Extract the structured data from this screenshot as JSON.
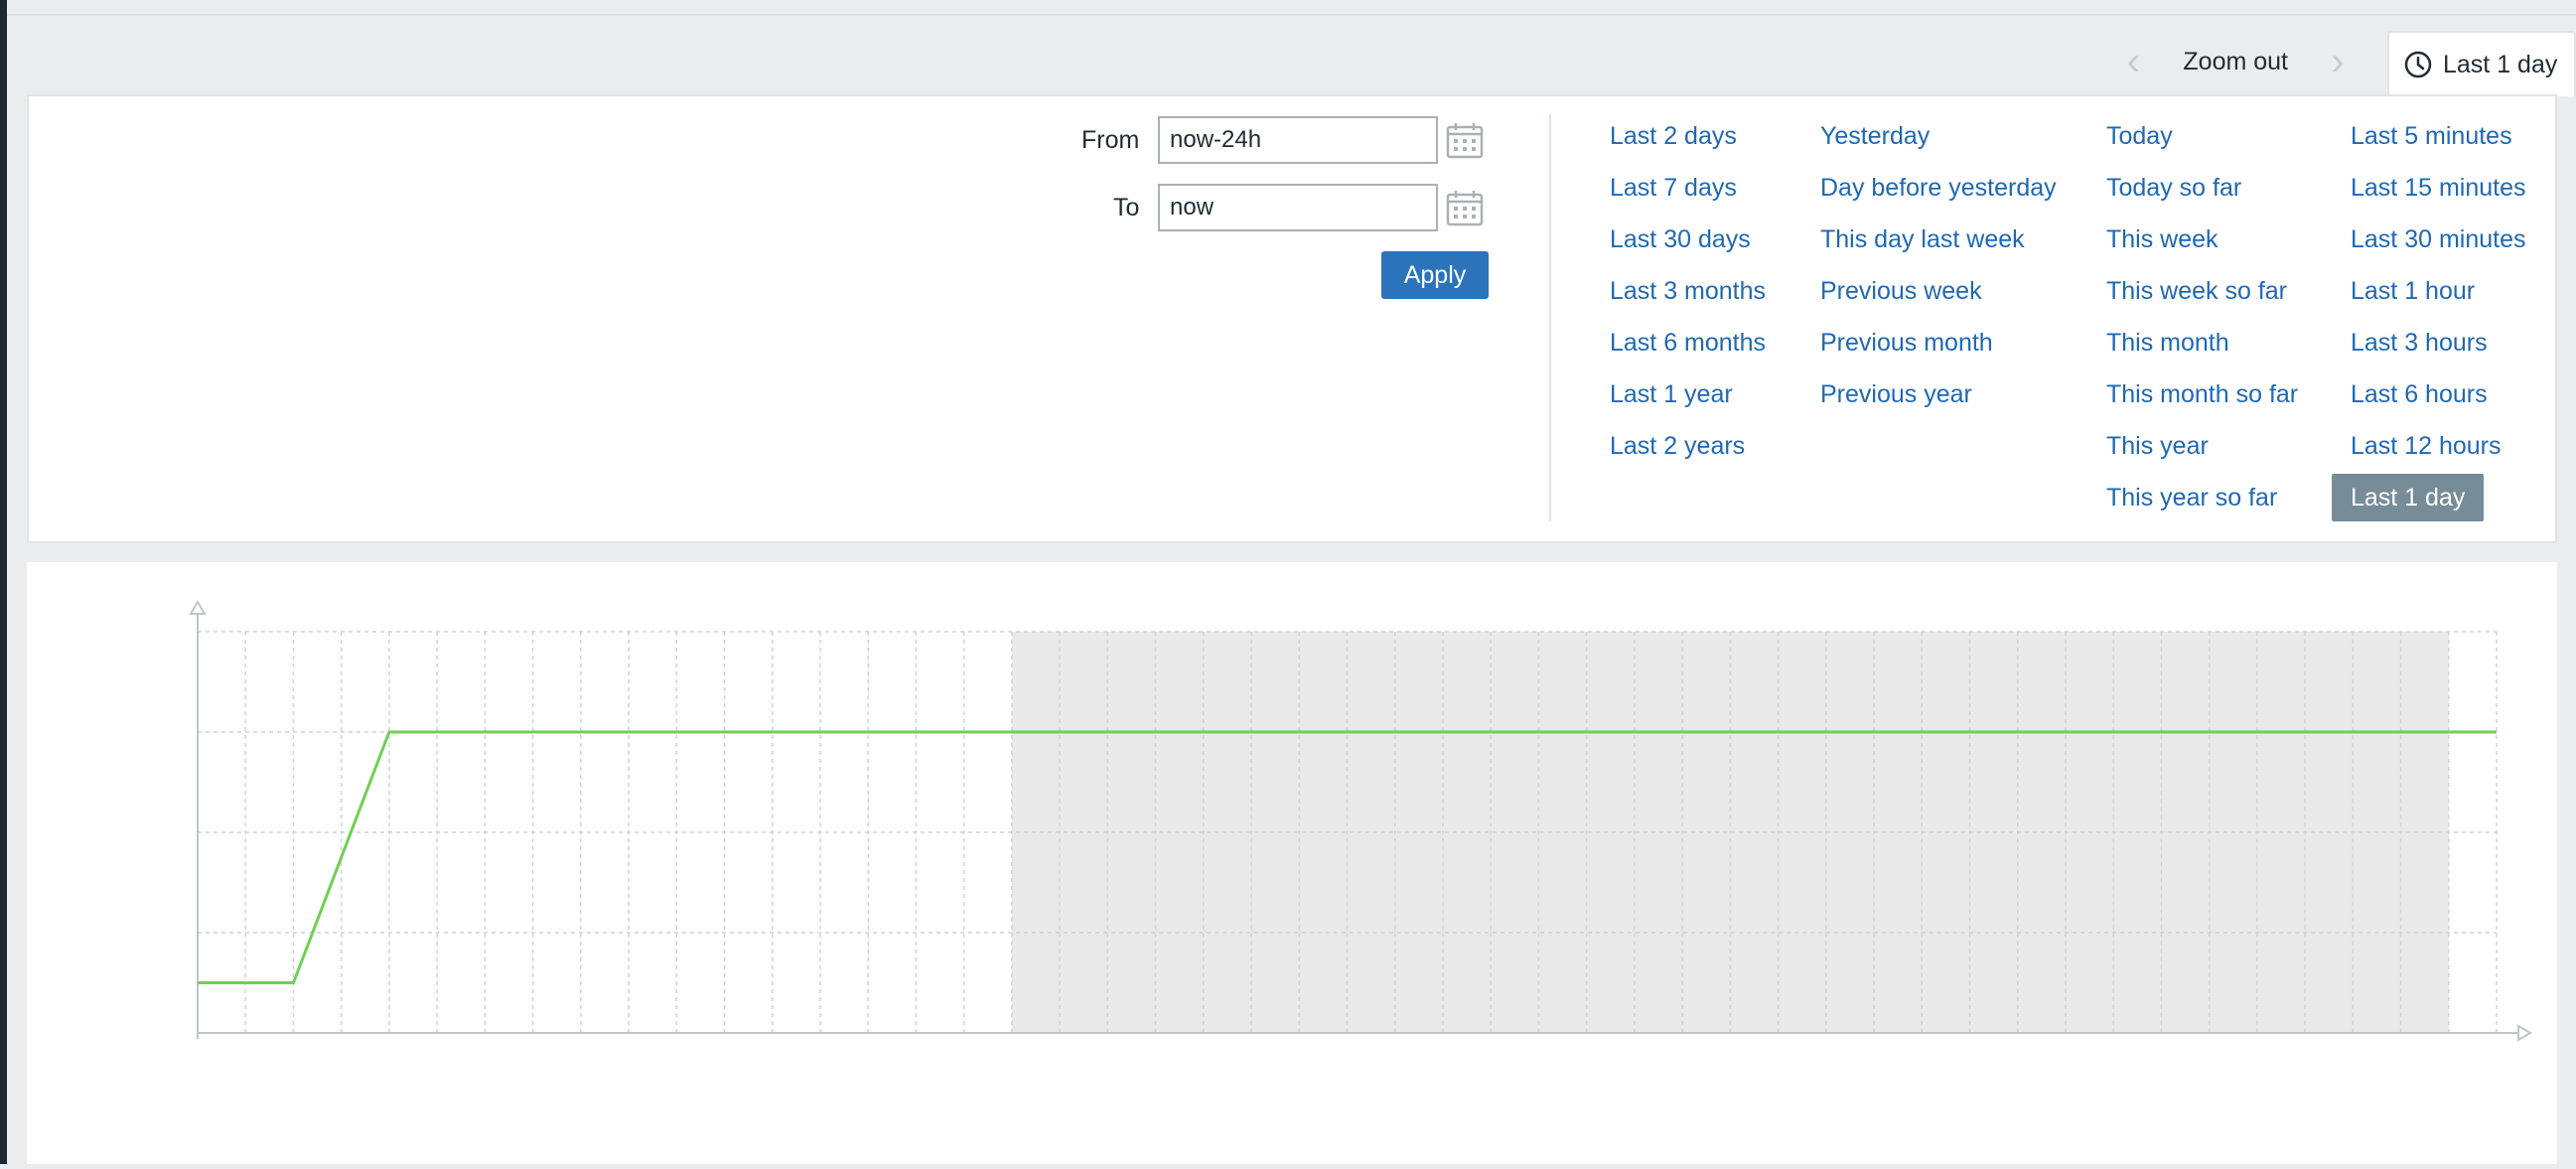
{
  "toolbar": {
    "prev_icon": "chevron-left-icon",
    "next_icon": "chevron-right-icon",
    "zoom_out_label": "Zoom out",
    "clock_icon": "clock-icon",
    "time_tab_label": "Last 1 day"
  },
  "filter": {
    "from_label": "From",
    "from_value": "now-24h",
    "to_label": "To",
    "to_value": "now",
    "apply_label": "Apply",
    "quick_ranges": [
      [
        "Last 2 days",
        "Last 7 days",
        "Last 30 days",
        "Last 3 months",
        "Last 6 months",
        "Last 1 year",
        "Last 2 years"
      ],
      [
        "Yesterday",
        "Day before yesterday",
        "This day last week",
        "Previous week",
        "Previous month",
        "Previous year"
      ],
      [
        "Today",
        "Today so far",
        "This week",
        "This week so far",
        "This month",
        "This month so far",
        "This year",
        "This year so far"
      ],
      [
        "Last 5 minutes",
        "Last 15 minutes",
        "Last 30 minutes",
        "Last 1 hour",
        "Last 3 hours",
        "Last 6 hours",
        "Last 12 hours",
        "Last 1 day"
      ]
    ],
    "selected": "Last 1 day"
  },
  "colors": {
    "link": "#1f68b3",
    "apply_button": "#2b74bc",
    "selected_bg": "#768d99",
    "series_line": "#6fd052",
    "shaded_area": "#e9e9e9"
  },
  "chart_data": {
    "type": "line",
    "grid": true,
    "x_divisions": 48,
    "y_divisions": 4,
    "ylim": [
      0,
      4
    ],
    "series": [
      {
        "points": [
          [
            0,
            0.5
          ],
          [
            2,
            0.5
          ],
          [
            4,
            3
          ],
          [
            48,
            3
          ]
        ]
      }
    ],
    "shaded_range": [
      17,
      47
    ]
  }
}
